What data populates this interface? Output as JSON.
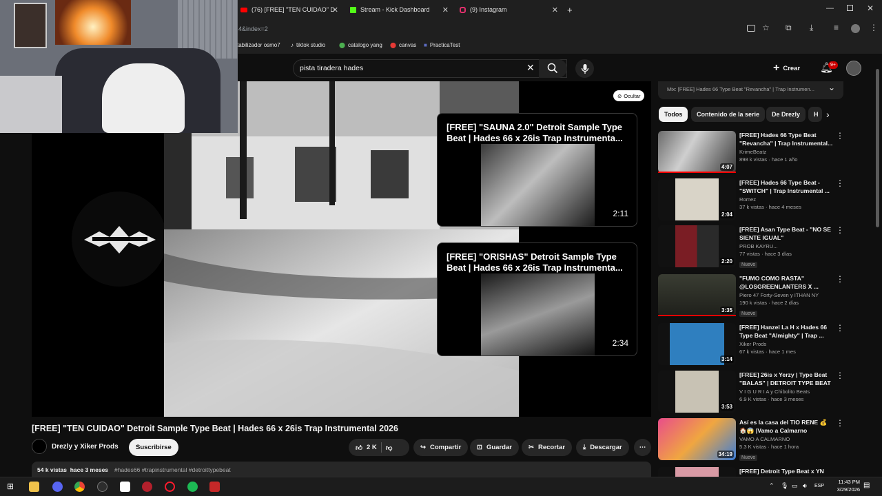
{
  "browser": {
    "tabs": [
      {
        "label": "(76) [FREE] \"TEN CUIDAO\" D",
        "favicon": "youtube-icon",
        "color": "#ff0000"
      },
      {
        "label": "Stream - Kick Dashboard",
        "favicon": "kick-icon",
        "color": "#53fc18"
      },
      {
        "label": "(9) Instagram",
        "favicon": "instagram-icon",
        "color": "#e1306c"
      }
    ],
    "new_tab": "+",
    "address_fragment": "4&index=2",
    "bookmarks": [
      "tabilizador osmo7",
      "tiktok studio",
      "catalogo yang",
      "canvas",
      "PracticaTest"
    ]
  },
  "youtube": {
    "search_value": "pista tiradera hades",
    "create_label": "Crear",
    "notif_badge": "9+",
    "ocultar_label": "Ocultar",
    "end_cards": [
      {
        "title": "[FREE] \"SAUNA 2.0\" Detroit Sample Type Beat | Hades 66 x 26is Trap Instrumenta...",
        "duration": "2:11"
      },
      {
        "title": "[FREE] \"ORISHAS\" Detroit Sample Type Beat | Hades 66 x 26is Trap Instrumenta...",
        "duration": "2:34"
      }
    ],
    "video_title": "[FREE] \"TEN CUIDAO\" Detroit Sample Type Beat | Hades 66 x 26is Trap Instrumental 2026",
    "channel": "Drezly y Xiker Prods",
    "subscribe_label": "Suscribirse",
    "actions": {
      "likes": "2 K",
      "share": "Compartir",
      "save": "Guardar",
      "clip": "Recortar",
      "download": "Descargar"
    },
    "desc_views": "54 k vistas  hace 3 meses",
    "desc_tags": "#hades66 #trapinstrumental #detroittypebeat",
    "mix_label": "Mix: [FREE] Hades 66 Type Beat \"Revancha\" | Trap Instrumen...",
    "chips": [
      "Todos",
      "Contenido de la serie",
      "De Drezly",
      "H"
    ],
    "recommendations": [
      {
        "title": "[FREE] Hades 66 Type Beat \"Revancha\" | Trap Instrumental...",
        "channel": "KrimeBeatz",
        "stats": "898 k vistas · hace 1 año",
        "duration": "4:07",
        "badge": ""
      },
      {
        "title": "[FREE] Hades 66 Type Beat - \"SWITCH\" | Trap Instrumental ...",
        "channel": "Romez",
        "stats": "37 k vistas · hace 4 meses",
        "duration": "2:04",
        "badge": ""
      },
      {
        "title": "[FREE] Asan Type Beat - \"NO SE SIENTE IGUAL\"",
        "channel": "PROB KAYRU...",
        "stats": "77 vistas · hace 3 días",
        "duration": "2:20",
        "badge": "Nuevo"
      },
      {
        "title": "\"FUMO COMO RASTA\" @LOSGREENLANTERS X ...",
        "channel": "Piero 47 Forty-Seven y ITHAN NY",
        "stats": "190 k vistas · hace 2 días",
        "duration": "3:35",
        "badge": "Nuevo"
      },
      {
        "title": "[FREE] Hanzel La H x Hades 66 Type Beat \"Almighty\" | Trap ...",
        "channel": "Xiker Prods",
        "stats": "67 k vistas · hace 1 mes",
        "duration": "3:14",
        "badge": ""
      },
      {
        "title": "[FREE]  26is x Yerzy | Type Beat \"BALAS\" | DETROIT TYPE BEAT",
        "channel": "V I G U R I A y Chibolito Beats",
        "stats": "6.9 K vistas · hace 3 meses",
        "duration": "3:53",
        "badge": ""
      },
      {
        "title": "Así es la casa del TIO RENE 💰 🏠😱 |Vamo a Calmarno",
        "channel": "VAMO A CALMARNO",
        "stats": "5.3 K vistas · hace 1 hora",
        "duration": "34:19",
        "badge": "Nuevo"
      },
      {
        "title": "[FREE] Detroit Type Beat x YN",
        "channel": "",
        "stats": "",
        "duration": "",
        "badge": ""
      }
    ]
  },
  "taskbar": {
    "lang": "ESP",
    "time": "11:43 PM",
    "date": "3/29/2026"
  },
  "colors": {
    "yt_red": "#ff0000",
    "bg": "#0f0f0f"
  }
}
